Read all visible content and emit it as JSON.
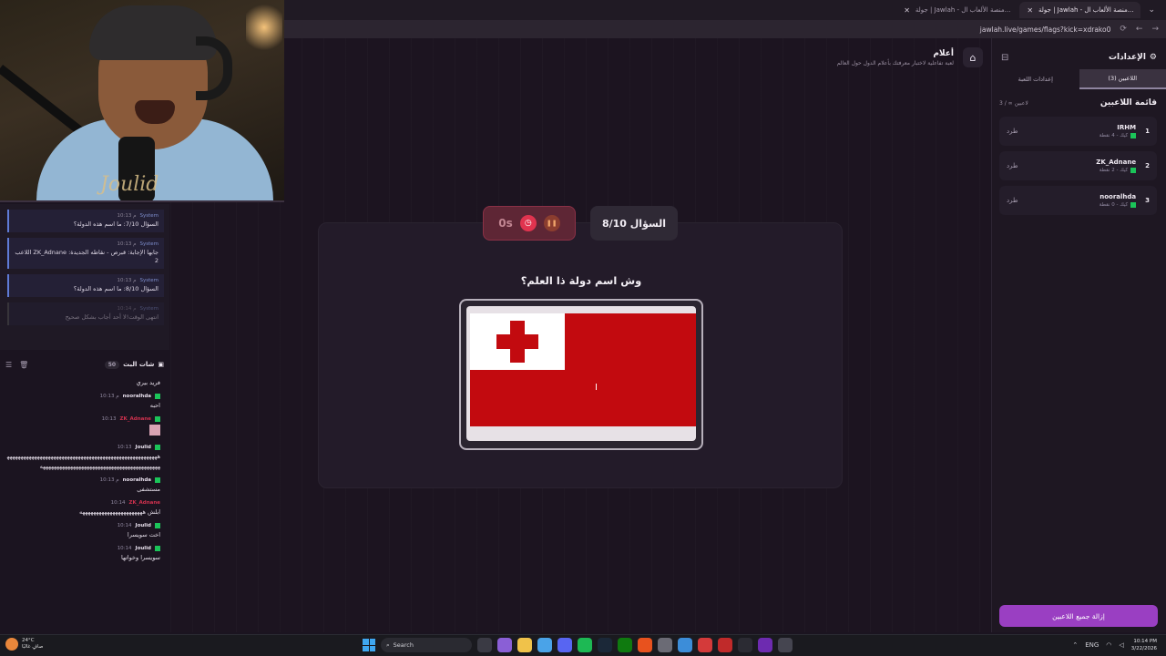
{
  "browser": {
    "tabs": [
      {
        "label": "جولة | Jawlah - منصة الألعاب ال..."
      },
      {
        "label": "جولة | Jawlah - منصة الألعاب ال..."
      }
    ],
    "url": "jawlah.live/games/flags?kick=xdrako0"
  },
  "game": {
    "title": "أعلام",
    "subtitle": "لعبة تفاعلية لاختبار معرفتك بأعلام الدول حول العالم",
    "question_counter": "السؤال 8/10",
    "timer": "0s",
    "question": "وش اسم دولة ذا العلم؟"
  },
  "sidebar": {
    "title": "الإعدادات",
    "tabs": [
      "اللاعبين (3)",
      "إعدادات اللعبة"
    ],
    "players_heading": "قائمة اللاعبين",
    "players_count": "3 / ∞ لاعبين",
    "players": [
      {
        "rank": "1",
        "name": "IRHM",
        "score": "كيك - 4 نقطة",
        "kick": "طرد"
      },
      {
        "rank": "2",
        "name": "ZK_Adnane",
        "score": "كيك - 2 نقطة",
        "kick": "طرد"
      },
      {
        "rank": "3",
        "name": "nooralhda",
        "score": "كيك - 0 نقطة",
        "kick": "طرد"
      }
    ],
    "remove_all": "إزالة جميع اللاعبين"
  },
  "system_messages": [
    {
      "sender": "System",
      "time": "10:13 م",
      "text": "السؤال 7/10: ما اسم هذه الدولة؟"
    },
    {
      "sender": "System",
      "time": "10:13 م",
      "text": "اللاعب ZK_Adnane جابها الإجابة: قبرص - نقاطه الجديدة: 2"
    },
    {
      "sender": "System",
      "time": "10:13 م",
      "text": "السؤال 8/10: ما اسم هذه الدولة؟"
    },
    {
      "sender": "System",
      "time": "10:14 م",
      "text": "انتهى الوقت!لا أحد أجاب بشكل صحيح"
    }
  ],
  "chat": {
    "title": "شات البث",
    "count": "50",
    "messages": [
      {
        "user": "",
        "time": "",
        "text": "فريد بيري"
      },
      {
        "user": "nooralhda",
        "time": "10:13 م",
        "text": "احبه"
      },
      {
        "user": "ZK_Adnane",
        "time": "10:13",
        "text": ""
      },
      {
        "user": "Joulid",
        "time": "10:13",
        "text": "هههههههههههههههههههههههههههههههههههههههههههههههههههههههههههههههههههههههههههههههههههههههههههههههههههه"
      },
      {
        "user": "nooralhda",
        "time": "10:13 م",
        "text": "مستشفى"
      },
      {
        "user": "ZK_Adnane",
        "time": "10:14",
        "text": "ابلش هههههههههههههههههههههههه"
      },
      {
        "user": "Joulid",
        "time": "10:14",
        "text": "اخت سويسرا"
      },
      {
        "user": "Joulid",
        "time": "10:14",
        "text": "سويسرا وخواتها"
      }
    ]
  },
  "webcam": {
    "signature": "Joulid"
  },
  "taskbar": {
    "weather_temp": "24°C",
    "weather_desc": "صافٍ غالبًا",
    "search_placeholder": "Search",
    "lang": "ENG",
    "time": "10:14 PM",
    "date": "3/22/2026"
  },
  "colors": {
    "flag_red": "#c20a0f",
    "accent_purple": "#9a3fc2",
    "timer_bg": "#5e2635",
    "kick_green": "#1bc459"
  }
}
